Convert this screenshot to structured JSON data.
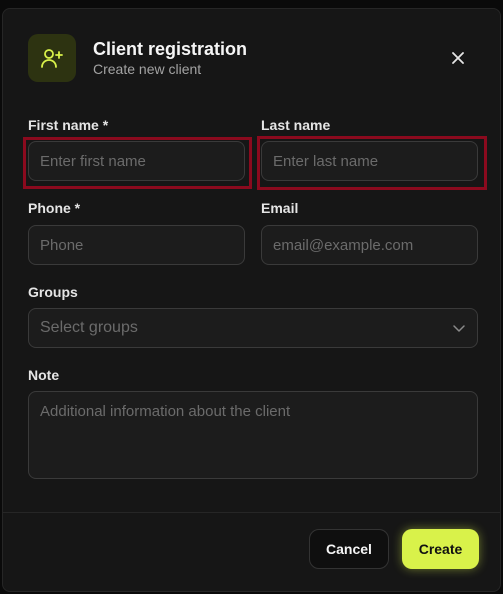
{
  "dialog": {
    "title": "Client registration",
    "subtitle": "Create new client",
    "icon": "user-plus-icon",
    "close_icon": "close-icon"
  },
  "form": {
    "first_name": {
      "label": "First name *",
      "placeholder": "Enter first name",
      "value": ""
    },
    "last_name": {
      "label": "Last name",
      "placeholder": "Enter last name",
      "value": ""
    },
    "phone": {
      "label": "Phone *",
      "placeholder": "Phone",
      "value": ""
    },
    "email": {
      "label": "Email",
      "placeholder": "email@example.com",
      "value": ""
    },
    "groups": {
      "label": "Groups",
      "placeholder": "Select groups"
    },
    "note": {
      "label": "Note",
      "placeholder": "Additional information about the client",
      "value": ""
    }
  },
  "footer": {
    "cancel_label": "Cancel",
    "create_label": "Create"
  },
  "colors": {
    "accent": "#d9f24a",
    "icon_bg": "#2d3311",
    "highlight": "#8b0a1e",
    "surface": "#161616"
  }
}
